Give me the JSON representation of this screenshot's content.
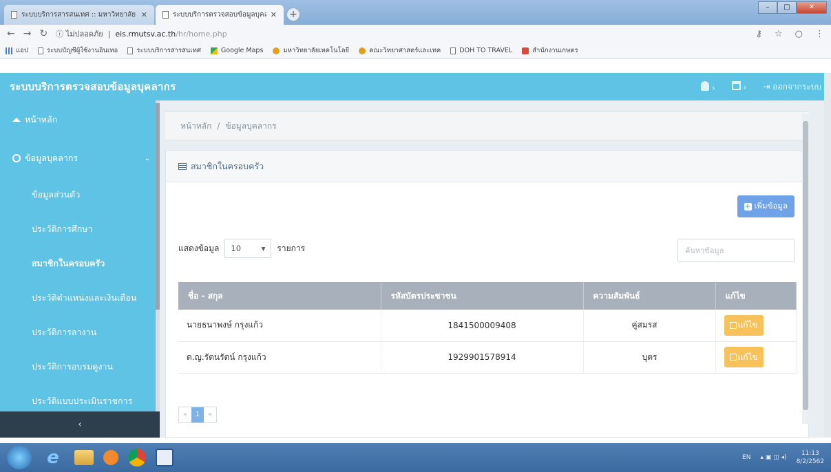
{
  "browser": {
    "tabs": [
      {
        "label": "ระบบบริการสารสนเทศ :: มหาวิทยาลัย",
        "active": false
      },
      {
        "label": "ระบบบริการตรวจสอบข้อมูลบุคลากร",
        "active": true
      }
    ],
    "address": {
      "security": "ไม่ปลอดภัย",
      "host": "eis.rmutsv.ac.th",
      "path": "/hr/home.php"
    },
    "bookmarks": [
      {
        "label": "แอป",
        "icon": "apps-grid-icon"
      },
      {
        "label": "ระบบบัญชีผู้ใช้งานอินเทอ",
        "icon": "page-icon"
      },
      {
        "label": "ระบบบริการสารสนเทศ",
        "icon": "page-icon"
      },
      {
        "label": "Google Maps",
        "icon": "maps-icon"
      },
      {
        "label": "มหาวิทยาลัยเทคโนโลยี",
        "icon": "rmut-icon"
      },
      {
        "label": "คณะวิทยาศาสตร์และเทค",
        "icon": "rmut-icon"
      },
      {
        "label": "DOH TO TRAVEL",
        "icon": "page-icon"
      },
      {
        "label": "สำนักงานเกษตร",
        "icon": "red-square-icon"
      }
    ]
  },
  "app": {
    "title": "ระบบบริการตรวจสอบข้อมูลบุคลากร",
    "logout_label": "ออกจากระบบ",
    "accent": "#5ec3e4"
  },
  "sidebar": {
    "home_label": "หน้าหลัก",
    "personnel_label": "ข้อมูลบุคลากร",
    "items": [
      {
        "label": "ข้อมูลส่วนตัว",
        "active": false
      },
      {
        "label": "ประวัติการศึกษา",
        "active": false
      },
      {
        "label": "สมาชิกในครอบครัว",
        "active": true
      },
      {
        "label": "ประวัติตำแหน่งและเงินเดือน",
        "active": false
      },
      {
        "label": "ประวัติการลางาน",
        "active": false
      },
      {
        "label": "ประวัติการอบรมดูงาน",
        "active": false
      },
      {
        "label": "ประวัติแบบประเมินราชการ",
        "active": false
      }
    ],
    "collapse_label": "‹"
  },
  "main": {
    "breadcrumb": {
      "home": "หน้าหลัก",
      "separator": "/",
      "current": "ข้อมูลบุคลากร"
    },
    "panel_title": "สมาชิกในครอบครัว",
    "add_button_label": "เพิ่มข้อมูล",
    "length": {
      "show_label": "แสดงข้อมูล",
      "value": "10",
      "suffix_label": "รายการ"
    },
    "search": {
      "placeholder": "ค้นหาข้อมูล",
      "value": ""
    },
    "table": {
      "columns": [
        "ชื่อ - สกุล",
        "รหัสบัตรประชาชน",
        "ความสัมพันธ์",
        "แก้ไข"
      ],
      "rows": [
        {
          "name": "นายธนาพงษ์ กรุงแก้ว",
          "id": "1841500009408",
          "relation": "คู่สมรส",
          "edit": "แก้ไข"
        },
        {
          "name": "ด.ญ.รัตนรัตน์ กรุงแก้ว",
          "id": "1929901578914",
          "relation": "บุตร",
          "edit": "แก้ไข"
        }
      ]
    },
    "pagination": {
      "prev": "«",
      "current": "1",
      "next": "»"
    }
  },
  "taskbar": {
    "lang": "EN",
    "time": "11:13",
    "date": "8/2/2562"
  }
}
